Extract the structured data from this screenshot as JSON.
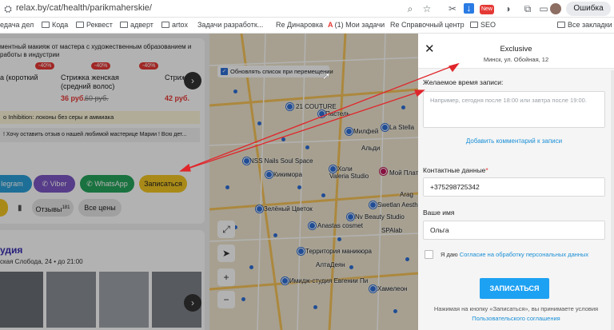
{
  "browser": {
    "url": "relax.by/cat/health/parikmaherskie/",
    "profile_label": "Ошибка",
    "bookmarks": [
      {
        "label": "едача дел",
        "folder": false
      },
      {
        "label": "Кода",
        "folder": true
      },
      {
        "label": "Реквест",
        "folder": true
      },
      {
        "label": "адверт",
        "folder": true
      },
      {
        "label": "artox",
        "folder": true
      },
      {
        "label": "Задачи разработк...",
        "folder": false
      },
      {
        "label": "Re Динаровка",
        "folder": false
      },
      {
        "label": "(1) Мои задачи",
        "folder": false
      },
      {
        "label": "Re Справочный центр",
        "folder": false
      },
      {
        "label": "SEO",
        "folder": true
      },
      {
        "label": "Все закладки",
        "folder": true
      }
    ],
    "new_badge": "New"
  },
  "left": {
    "desc_line1": "ментный макияж от мастера с художественным образованием и",
    "desc_line2": "работы в индустрии",
    "services": [
      {
        "name": "а (короткий",
        "price": "",
        "old": "",
        "badge": "-40%"
      },
      {
        "name": "Стрижка женская (средний волос)",
        "price": "36 руб.",
        "old": "60 руб.",
        "badge": "-40%"
      },
      {
        "name": "Стриж",
        "price": "42 руб.",
        "old": "",
        "badge": "-40%"
      }
    ],
    "promo": "о Inhibition: локоны без серы и аммиака",
    "review": "! Хочу оставить отзыв о нашей любимой мастерице Марии ! Всю дет...",
    "btn_telegram": "legram",
    "btn_viber": "Viber",
    "btn_whatsapp": "WhatsApp",
    "btn_signup": "Записаться",
    "reviews_label": "Отзывы",
    "reviews_count": "181",
    "all_prices": "Все цены",
    "studio_title": "удия",
    "studio_addr": "ская Слобода, 24",
    "studio_hours": "до 21:00"
  },
  "map": {
    "refresh_label": "Обновлять список при перемещении",
    "labels": [
      "21 COUTURE",
      "Пастель",
      "La Stella",
      "Милфей",
      "Альди",
      "NSS Nails Soul Space",
      "Холи",
      "Мой Платин",
      "Кикимора",
      "Valeria Studio",
      "Arag",
      "Зелёный Цветок",
      "Swetlan Aesthetics",
      "Nv Beauty Studio",
      "Anastas cosmet",
      "SPAlab",
      "Территория маникюра",
      "АлтаДеян",
      "Имидж-студия Евгении Пи",
      "Хамелеон"
    ]
  },
  "panel": {
    "salon_name": "Exclusive",
    "salon_address": "Минск, ул. Обойная, 12",
    "time_label": "Желаемое время записи:",
    "time_placeholder": "Например, сегодня после 18:00 или завтра после 19:00.",
    "add_comment": "Добавить комментарий к записи",
    "contact_label": "Контактные данные",
    "phone": "+375298725342",
    "name_label": "Ваше имя",
    "name_value": "Ольга",
    "consent_prefix": "Я даю",
    "consent_link": "Согласие на обработку персональных данных",
    "submit": "ЗАПИСАТЬСЯ",
    "footer_text": "Нажимая на кнопку «Записаться», вы принимаете условия",
    "footer_link": "Пользовательского соглашения"
  },
  "colors": {
    "accent": "#1da1f2",
    "link": "#1a8fd6",
    "annotation": "#e0262b",
    "signup": "#f3c623",
    "whatsapp": "#25a45b",
    "viber": "#7c56c4",
    "telegram": "#2b9fd8"
  }
}
